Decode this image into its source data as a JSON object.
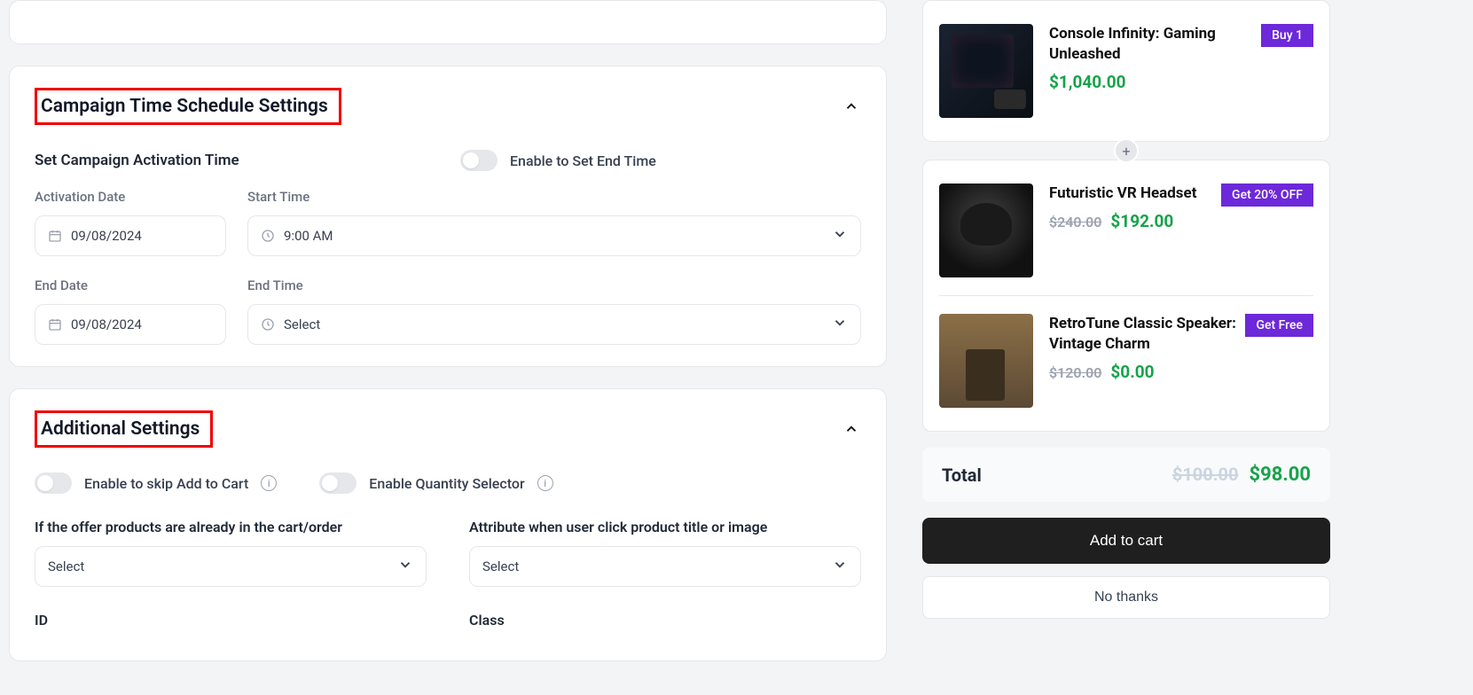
{
  "schedule": {
    "title": "Campaign Time Schedule Settings",
    "subheading": "Set Campaign Activation Time",
    "end_toggle_label": "Enable to Set End Time",
    "activation_date_label": "Activation Date",
    "activation_date_value": "09/08/2024",
    "start_time_label": "Start Time",
    "start_time_value": "9:00 AM",
    "end_date_label": "End Date",
    "end_date_value": "09/08/2024",
    "end_time_label": "End Time",
    "end_time_value": "Select"
  },
  "additional": {
    "title": "Additional Settings",
    "skip_cart_label": "Enable to skip Add to Cart",
    "qty_selector_label": "Enable Quantity Selector",
    "already_in_cart_label": "If the offer products are already in the cart/order",
    "already_in_cart_value": "Select",
    "attribute_label": "Attribute when user click product title or image",
    "attribute_value": "Select",
    "id_label": "ID",
    "class_label": "Class"
  },
  "preview": {
    "products": [
      {
        "title": "Console Infinity: Gaming Unleashed",
        "price": "$1,040.00",
        "old_price": "",
        "badge": "Buy 1"
      },
      {
        "title": "Futuristic VR Headset",
        "price": "$192.00",
        "old_price": "$240.00",
        "badge": "Get 20% OFF"
      },
      {
        "title": "RetroTune Classic Speaker: Vintage Charm",
        "price": "$0.00",
        "old_price": "$120.00",
        "badge": "Get Free"
      }
    ],
    "total_label": "Total",
    "total_old": "$100.00",
    "total_value": "$98.00",
    "add_to_cart": "Add to cart",
    "no_thanks": "No thanks"
  }
}
